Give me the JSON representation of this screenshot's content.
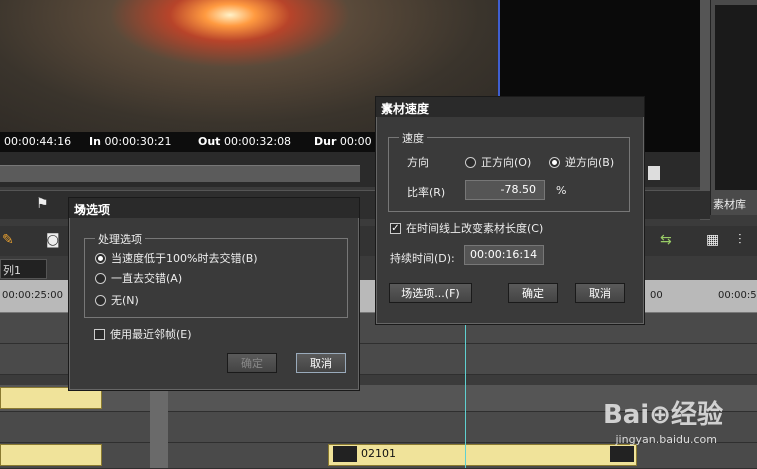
{
  "timecodes": {
    "current": "00:00:44:16",
    "in_label": "In",
    "in_value": "00:00:30:21",
    "out_label": "Out",
    "out_value": "00:00:32:08",
    "dur_label": "Dur",
    "dur_value": "00:00"
  },
  "library_label": "素材库",
  "track_tab": "列1",
  "ruler": [
    "00:00:25:00",
    "00",
    "00:00:5"
  ],
  "clip_label": "02101",
  "field_dialog": {
    "title": "场选项",
    "group_label": "处理选项",
    "options": [
      "当速度低于100%时去交错(B)",
      "一直去交错(A)",
      "无(N)"
    ],
    "selected_index": 0,
    "checkbox_label": "使用最近邻帧(E)",
    "checkbox_checked": false,
    "ok_label": "确定",
    "cancel_label": "取消"
  },
  "speed_dialog": {
    "title": "素材速度",
    "group_label": "速度",
    "direction_label": "方向",
    "forward_label": "正方向(O)",
    "reverse_label": "逆方向(B)",
    "direction_selected": "reverse",
    "rate_label": "比率(R)",
    "rate_value": "-78.50",
    "rate_unit": "%",
    "change_length_label": "在时间线上改变素材长度(C)",
    "change_length_checked": true,
    "duration_label": "持续时间(D):",
    "duration_value": "00:00:16:14",
    "field_options_button": "场选项...(F)",
    "ok_label": "确定",
    "cancel_label": "取消"
  },
  "watermark": {
    "brand": "Bai⊕经验",
    "url": "jingyan.baidu.com"
  }
}
